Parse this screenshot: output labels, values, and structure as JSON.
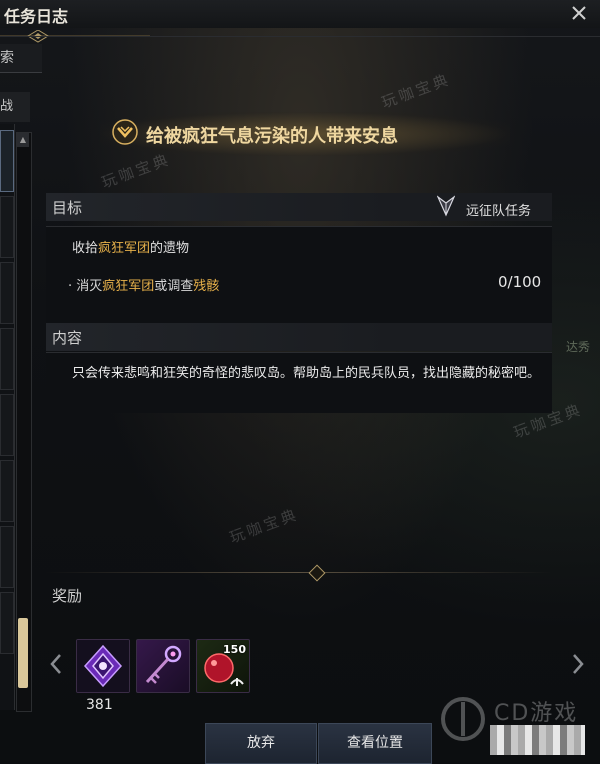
{
  "window": {
    "title": "任务日志",
    "close_symbol": "X"
  },
  "sidebar": {
    "search_label": "索",
    "filter_label": "战"
  },
  "quest": {
    "title": "给被疯狂气息污染的人带来安息",
    "type_label": "远征队任务",
    "objective_header": "目标",
    "objective_title_prefix": "收拾",
    "objective_title_hl": "疯狂军团",
    "objective_title_suffix": "的遗物",
    "sub_bullet": "· 消灭",
    "sub_hl1": "疯狂军团",
    "sub_mid": "或调查",
    "sub_hl2": "残骸",
    "sub_progress": "0/100",
    "content_header": "内容",
    "description": "只会传来悲鸣和狂笑的奇怪的悲叹岛。帮助岛上的民兵队员，找出隐藏的秘密吧。",
    "reward_header": "奖励"
  },
  "rewards": [
    {
      "icon": "purple-crystal-icon",
      "count_below": "381"
    },
    {
      "icon": "magic-key-icon"
    },
    {
      "icon": "red-fruit-icon",
      "count_badge": "150"
    }
  ],
  "buttons": {
    "abandon": "放弃",
    "view_location": "查看位置"
  },
  "watermark": "玩咖宝典",
  "external": {
    "side_text1": "达秀",
    "logo_text": "CD游戏"
  },
  "colors": {
    "highlight": "#e6b04a",
    "title_gold": "#efd7a0",
    "scroll_thumb": "#d9c79a"
  }
}
